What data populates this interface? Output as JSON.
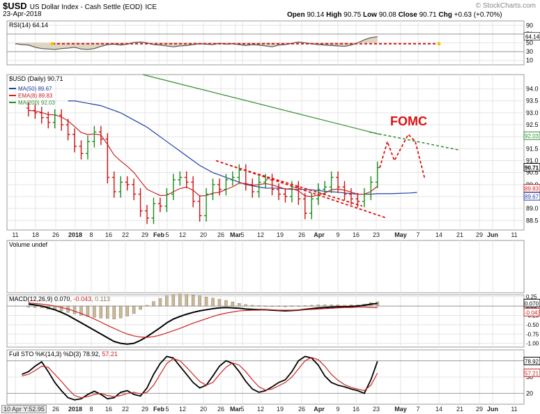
{
  "header": {
    "symbol": "$USD",
    "description": "US Dollar Index - Cash Settle (EOD)",
    "exchange": "ICE",
    "date": "23-Apr-2018",
    "open_label": "Open",
    "open": "90.14",
    "high_label": "High",
    "high": "90.75",
    "low_label": "Low",
    "low": "90.08",
    "close_label": "Close",
    "close": "90.71",
    "chg_label": "Chg",
    "chg": "+0.63 (+0.70%)",
    "brand": "© StockCharts.com"
  },
  "chart_data": [
    {
      "type": "line",
      "panel": "RSI",
      "title": "RSI(14) 64.14",
      "y_ticks": [
        10,
        30,
        50,
        70,
        90
      ],
      "ylim": [
        0,
        100
      ],
      "overbought": 70,
      "oversold": 30,
      "last_value_label": "64.14",
      "series": [
        {
          "name": "RSI(14)",
          "values": [
            48,
            46,
            45,
            40,
            37,
            36,
            35,
            37,
            38,
            40,
            36,
            35,
            37,
            42,
            46,
            47,
            45,
            47,
            51,
            52,
            50,
            46,
            45,
            43,
            41,
            43,
            44,
            46,
            48,
            47,
            46,
            49,
            47,
            48,
            46,
            44,
            46,
            45,
            43,
            41,
            45,
            46,
            49,
            52,
            50,
            48,
            46,
            45,
            44,
            43,
            42,
            45,
            50,
            57,
            62,
            64
          ]
        }
      ],
      "dotted_line": 48
    },
    {
      "type": "candlestick",
      "panel": "price",
      "title": "$USD (Daily) 90.71",
      "legend": [
        {
          "name": "MA(50) 89.67",
          "color": "#1f3fa6"
        },
        {
          "name": "EMA(8) 89.83",
          "color": "#cc2222"
        },
        {
          "name": "MA(200) 92.03",
          "color": "#2e8b2e"
        }
      ],
      "y_ticks": [
        88.5,
        89.0,
        89.5,
        90.0,
        90.5,
        91.0,
        91.5,
        92.0,
        92.5,
        93.0,
        93.5,
        94.0
      ],
      "ylim": [
        88.1,
        94.6
      ],
      "x_tick_labels": [
        "11",
        "18",
        "26",
        "2018",
        "8",
        "16",
        "22",
        "29",
        "Feb",
        "5",
        "12",
        "20",
        "26",
        "Mar",
        "5",
        "12",
        "19",
        "26",
        "Apr",
        "9",
        "16",
        "23",
        "May",
        "7",
        "14",
        "21",
        "29",
        "Jun",
        "11"
      ],
      "closes": [
        93.1,
        93.0,
        92.8,
        92.6,
        92.9,
        92.5,
        92.1,
        91.6,
        91.3,
        91.8,
        92.2,
        91.9,
        90.3,
        89.7,
        90.1,
        90.0,
        89.6,
        88.9,
        88.6,
        89.2,
        89.1,
        89.6,
        90.2,
        90.3,
        90.1,
        89.3,
        88.7,
        89.6,
        90.0,
        89.8,
        90.2,
        90.3,
        90.6,
        90.0,
        89.7,
        90.1,
        90.2,
        89.8,
        89.6,
        89.5,
        89.9,
        89.4,
        88.8,
        89.4,
        89.8,
        89.9,
        90.3,
        89.9,
        89.6,
        89.4,
        89.3,
        89.6,
        90.1,
        90.71
      ],
      "annotation": "FOMC",
      "last_labels": [
        "92.03",
        "90.71",
        "89.83",
        "89.67"
      ]
    },
    {
      "type": "area",
      "panel": "volume",
      "title": "Volume undef",
      "values": []
    },
    {
      "type": "line",
      "panel": "MACD",
      "title_parts": [
        "MACD(12,26,9)",
        "0.070",
        "-0.043",
        "0.113"
      ],
      "y_ticks": [
        0.25,
        0.0,
        -0.25,
        -0.5,
        -0.75,
        -1.0
      ],
      "ylim": [
        -1.1,
        0.3
      ],
      "last_labels": [
        "0.070",
        "-0.043"
      ],
      "series": [
        {
          "name": "MACD",
          "values": [
            0.05,
            0.03,
            0.0,
            -0.05,
            -0.1,
            -0.17,
            -0.25,
            -0.35,
            -0.45,
            -0.55,
            -0.65,
            -0.75,
            -0.85,
            -0.95,
            -1.0,
            -1.02,
            -1.0,
            -0.92,
            -0.82,
            -0.7,
            -0.58,
            -0.45,
            -0.35,
            -0.28,
            -0.22,
            -0.17,
            -0.13,
            -0.1,
            -0.07,
            -0.05,
            -0.04,
            -0.05,
            -0.06,
            -0.08,
            -0.09,
            -0.1,
            -0.1,
            -0.11,
            -0.12,
            -0.13,
            -0.12,
            -0.11,
            -0.09,
            -0.07,
            -0.05,
            -0.04,
            -0.03,
            -0.02,
            -0.02,
            -0.01,
            0.0,
            0.02,
            0.05,
            0.07
          ]
        },
        {
          "name": "Signal",
          "values": [
            0.08,
            0.07,
            0.05,
            0.03,
            0.0,
            -0.04,
            -0.08,
            -0.14,
            -0.2,
            -0.27,
            -0.35,
            -0.43,
            -0.52,
            -0.6,
            -0.68,
            -0.75,
            -0.8,
            -0.83,
            -0.84,
            -0.82,
            -0.78,
            -0.72,
            -0.66,
            -0.6,
            -0.53,
            -0.46,
            -0.4,
            -0.34,
            -0.28,
            -0.23,
            -0.19,
            -0.16,
            -0.13,
            -0.12,
            -0.11,
            -0.11,
            -0.1,
            -0.1,
            -0.11,
            -0.11,
            -0.11,
            -0.11,
            -0.1,
            -0.09,
            -0.08,
            -0.07,
            -0.06,
            -0.05,
            -0.04,
            -0.04,
            -0.03,
            -0.03,
            -0.04,
            -0.043
          ]
        }
      ]
    },
    {
      "type": "line",
      "panel": "STO",
      "title_parts": [
        "Full STO %K(14,3) %D(3)",
        "78.92",
        "57.21"
      ],
      "y_ticks": [
        20,
        50,
        80
      ],
      "ylim": [
        0,
        100
      ],
      "last_labels": [
        "78.92",
        "57.21"
      ],
      "series": [
        {
          "name": "%K",
          "values": [
            55,
            60,
            70,
            78,
            60,
            40,
            25,
            12,
            8,
            10,
            18,
            24,
            18,
            10,
            12,
            22,
            25,
            18,
            15,
            30,
            55,
            75,
            88,
            85,
            70,
            55,
            40,
            30,
            35,
            52,
            70,
            80,
            75,
            60,
            42,
            28,
            22,
            25,
            32,
            40,
            45,
            60,
            80,
            88,
            85,
            72,
            52,
            40,
            35,
            32,
            28,
            25,
            20,
            45,
            78.92
          ]
        },
        {
          "name": "%D",
          "values": [
            52,
            55,
            62,
            70,
            68,
            55,
            42,
            28,
            16,
            12,
            14,
            18,
            20,
            16,
            14,
            16,
            20,
            22,
            19,
            22,
            35,
            55,
            75,
            84,
            80,
            68,
            55,
            42,
            35,
            40,
            55,
            68,
            76,
            72,
            60,
            45,
            32,
            26,
            28,
            34,
            40,
            50,
            65,
            80,
            86,
            82,
            70,
            55,
            44,
            36,
            31,
            28,
            25,
            35,
            57.21
          ]
        }
      ]
    }
  ],
  "footer": {
    "date_readout": "10 Apr Y:52.95"
  }
}
